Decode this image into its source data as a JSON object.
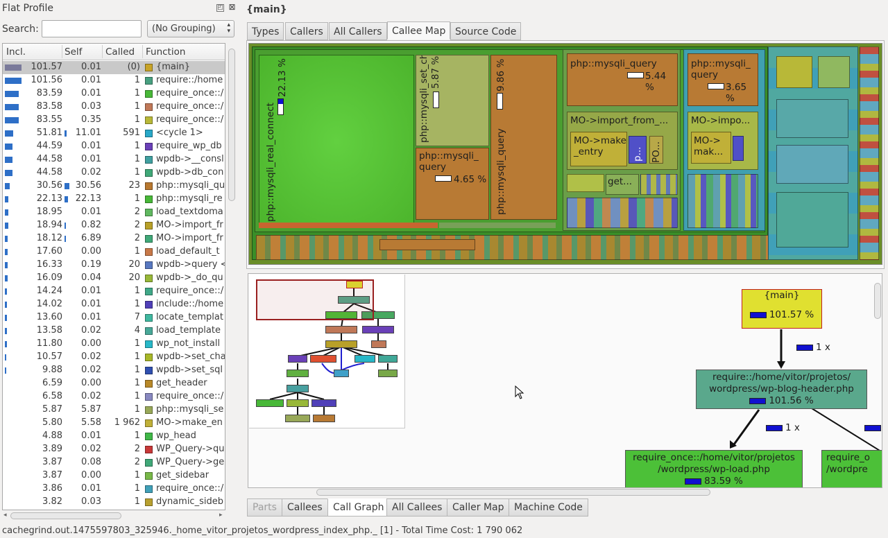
{
  "left": {
    "title": "Flat Profile",
    "search_label": "Search:",
    "search_value": "",
    "grouping": "(No Grouping)",
    "columns": [
      "Incl.",
      "Self",
      "Called",
      "Function"
    ],
    "rows": [
      {
        "incl": "101.57",
        "self": "0.01",
        "called": "(0)",
        "func": "{main}",
        "color": "#c8a428",
        "ibar": 1.0,
        "sbar": 0
      },
      {
        "incl": "101.56",
        "self": "0.01",
        "called": "1",
        "func": "require::/home",
        "color": "#48a080",
        "ibar": 1.0,
        "sbar": 0
      },
      {
        "incl": "83.59",
        "self": "0.01",
        "called": "1",
        "func": "require_once::/",
        "color": "#48b838",
        "ibar": 0.82,
        "sbar": 0
      },
      {
        "incl": "83.58",
        "self": "0.03",
        "called": "1",
        "func": "require_once::/",
        "color": "#c07858",
        "ibar": 0.82,
        "sbar": 0
      },
      {
        "incl": "83.55",
        "self": "0.35",
        "called": "1",
        "func": "require_once::/",
        "color": "#b8b838",
        "ibar": 0.82,
        "sbar": 0
      },
      {
        "incl": "51.81",
        "self": "11.01",
        "called": "591",
        "func": "<cycle 1>",
        "color": "#28a8c8",
        "ibar": 0.51,
        "sbar": 0.11
      },
      {
        "incl": "44.59",
        "self": "0.01",
        "called": "1",
        "func": "require_wp_db",
        "color": "#6a40b8",
        "ibar": 0.44,
        "sbar": 0
      },
      {
        "incl": "44.58",
        "self": "0.01",
        "called": "1",
        "func": "wpdb->__consl",
        "color": "#40a0a0",
        "ibar": 0.44,
        "sbar": 0
      },
      {
        "incl": "44.58",
        "self": "0.02",
        "called": "1",
        "func": "wpdb->db_con",
        "color": "#40a878",
        "ibar": 0.44,
        "sbar": 0
      },
      {
        "incl": "30.56",
        "self": "30.56",
        "called": "23",
        "func": "php::mysqli_qu",
        "color": "#b87830",
        "ibar": 0.3,
        "sbar": 0.3
      },
      {
        "incl": "22.13",
        "self": "22.13",
        "called": "1",
        "func": "php::mysqli_re",
        "color": "#48b838",
        "ibar": 0.22,
        "sbar": 0.22
      },
      {
        "incl": "18.95",
        "self": "0.01",
        "called": "2",
        "func": "load_textdoma",
        "color": "#60b860",
        "ibar": 0.19,
        "sbar": 0
      },
      {
        "incl": "18.94",
        "self": "0.82",
        "called": "2",
        "func": "MO->import_fr",
        "color": "#b8a028",
        "ibar": 0.19,
        "sbar": 0.01
      },
      {
        "incl": "18.12",
        "self": "6.89",
        "called": "2",
        "func": "MO->import_fr",
        "color": "#40a878",
        "ibar": 0.18,
        "sbar": 0.07
      },
      {
        "incl": "17.60",
        "self": "0.00",
        "called": "1",
        "func": "load_default_t",
        "color": "#c87848",
        "ibar": 0.17,
        "sbar": 0
      },
      {
        "incl": "16.33",
        "self": "0.19",
        "called": "20",
        "func": "wpdb->query <",
        "color": "#5878c0",
        "ibar": 0.16,
        "sbar": 0
      },
      {
        "incl": "16.09",
        "self": "0.04",
        "called": "20",
        "func": "wpdb->_do_qu",
        "color": "#98b838",
        "ibar": 0.16,
        "sbar": 0
      },
      {
        "incl": "14.24",
        "self": "0.01",
        "called": "1",
        "func": "require_once::/",
        "color": "#40a888",
        "ibar": 0.14,
        "sbar": 0
      },
      {
        "incl": "14.02",
        "self": "0.01",
        "called": "1",
        "func": "include::/home",
        "color": "#5040b8",
        "ibar": 0.14,
        "sbar": 0
      },
      {
        "incl": "13.60",
        "self": "0.01",
        "called": "7",
        "func": "locate_templat",
        "color": "#40b8a0",
        "ibar": 0.13,
        "sbar": 0
      },
      {
        "incl": "13.58",
        "self": "0.02",
        "called": "4",
        "func": "load_template",
        "color": "#48a898",
        "ibar": 0.13,
        "sbar": 0
      },
      {
        "incl": "11.80",
        "self": "0.00",
        "called": "1",
        "func": "wp_not_install",
        "color": "#28b8c8",
        "ibar": 0.12,
        "sbar": 0
      },
      {
        "incl": "10.57",
        "self": "0.02",
        "called": "1",
        "func": "wpdb->set_cha",
        "color": "#a8b828",
        "ibar": 0.1,
        "sbar": 0
      },
      {
        "incl": "9.88",
        "self": "0.02",
        "called": "1",
        "func": "wpdb->set_sql",
        "color": "#3050b0",
        "ibar": 0.1,
        "sbar": 0
      },
      {
        "incl": "6.59",
        "self": "0.00",
        "called": "1",
        "func": "get_header",
        "color": "#b88828",
        "ibar": 0,
        "sbar": 0
      },
      {
        "incl": "6.58",
        "self": "0.02",
        "called": "1",
        "func": "require_once::/",
        "color": "#8888c0",
        "ibar": 0,
        "sbar": 0
      },
      {
        "incl": "5.87",
        "self": "5.87",
        "called": "1",
        "func": "php::mysqli_se",
        "color": "#98a858",
        "ibar": 0,
        "sbar": 0
      },
      {
        "incl": "5.80",
        "self": "5.58",
        "called": "1 962",
        "func": "MO->make_en",
        "color": "#c0b038",
        "ibar": 0,
        "sbar": 0
      },
      {
        "incl": "4.88",
        "self": "0.01",
        "called": "1",
        "func": "wp_head",
        "color": "#40b848",
        "ibar": 0,
        "sbar": 0
      },
      {
        "incl": "3.89",
        "self": "0.02",
        "called": "2",
        "func": "WP_Query->qu",
        "color": "#c83838",
        "ibar": 0,
        "sbar": 0
      },
      {
        "incl": "3.87",
        "self": "0.08",
        "called": "2",
        "func": "WP_Query->ge",
        "color": "#40a878",
        "ibar": 0,
        "sbar": 0
      },
      {
        "incl": "3.87",
        "self": "0.00",
        "called": "1",
        "func": "get_sidebar",
        "color": "#78b848",
        "ibar": 0,
        "sbar": 0
      },
      {
        "incl": "3.86",
        "self": "0.01",
        "called": "1",
        "func": "require_once::/",
        "color": "#40a0b8",
        "ibar": 0,
        "sbar": 0
      },
      {
        "incl": "3.82",
        "self": "0.03",
        "called": "1",
        "func": "dynamic_sideb",
        "color": "#b8a030",
        "ibar": 0,
        "sbar": 0
      }
    ]
  },
  "main": {
    "title": "{main}",
    "top_tabs": [
      "Types",
      "Callers",
      "All Callers",
      "Callee Map",
      "Source Code"
    ],
    "active_top_tab": 3,
    "bottom_tabs": [
      "Parts",
      "Callees",
      "Call Graph",
      "All Callees",
      "Caller Map",
      "Machine Code"
    ],
    "active_bottom_tab": 2
  },
  "treemap": {
    "labels": {
      "real_connect": "php::mysqli_real_connect",
      "real_connect_pct": "22.13 %",
      "set_charset": "php::mysqli_set_charset",
      "set_charset_pct": "5.87 %",
      "query_a": "php::mysqli_ query",
      "query_a_pct": "4.65 %",
      "query_b": "php::mysqli_query",
      "query_b_pct": "9.86 %",
      "query_c": "php::mysqli_query",
      "query_c_pct": "5.44 %",
      "query_d": "php::mysqli_ query",
      "query_d_pct": "3.65 %",
      "import_a": "MO->import_from_...",
      "make_entry": "MO->make _entry",
      "p_small": "p...",
      "po_small": "PO...",
      "import_b": "MO->impo...",
      "mak_b": "MO-> mak...",
      "get_small": "get..."
    },
    "colors": {
      "green": "#55c238",
      "brown": "#b87a34",
      "olive": "#a8b860",
      "yellow": "#b8b840",
      "blue": "#5050c8"
    }
  },
  "graph": {
    "main_node": {
      "name": "{main}",
      "value": "101.57 %"
    },
    "blog_node": {
      "name": "require::/home/vitor/projetos/ wordpress/wp-blog-header.php",
      "value": "101.56 %"
    },
    "load_node": {
      "name": "require_once::/home/vitor/projetos /wordpress/wp-load.php",
      "value": "83.59 %"
    },
    "right_node": {
      "name": "require_o /wordpre",
      "value": ""
    },
    "edge1": "1 x",
    "edge2": "1 x"
  },
  "statusbar": "cachegrind.out.1475597803_325946._home_vitor_projetos_wordpress_index_php._ [1] - Total Time Cost: 1 790 062"
}
